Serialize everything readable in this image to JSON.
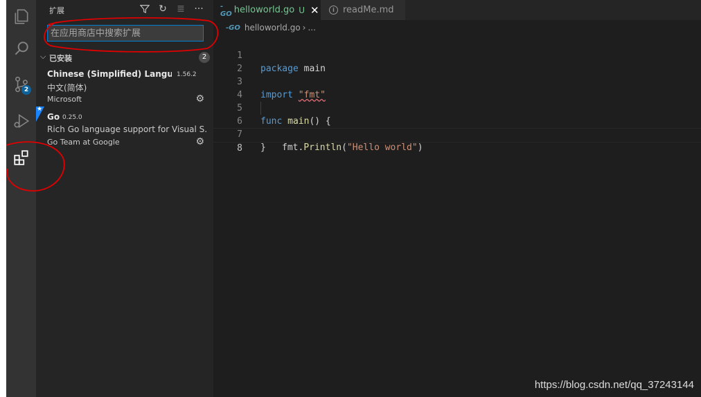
{
  "sidebar": {
    "title": "扩展",
    "search": {
      "placeholder": "在应用商店中搜索扩展",
      "value": ""
    },
    "section": {
      "label": "已安装",
      "count": "2"
    },
    "extensions": [
      {
        "name": "Chinese (Simplified) Langu...",
        "version": "1.56.2",
        "description": "中文(简体)",
        "publisher": "Microsoft"
      },
      {
        "name": "Go",
        "version": "0.25.0",
        "description": "Rich Go language support for Visual S...",
        "publisher": "Go Team at Google"
      }
    ]
  },
  "activity": {
    "scm_badge": "2"
  },
  "tabs": [
    {
      "label": "helloworld.go",
      "status": "U",
      "icon": "go-icon"
    },
    {
      "label": "readMe.md",
      "icon": "info-icon"
    }
  ],
  "breadcrumb": {
    "file": "helloworld.go",
    "more": "..."
  },
  "code": {
    "line_numbers": [
      "1",
      "2",
      "3",
      "4",
      "5",
      "6",
      "7",
      "8"
    ],
    "l1_kw": "package",
    "l1_rest": " main",
    "l3_kw": "import",
    "l3_str": "\"fmt\"",
    "l5_kw": "func",
    "l5_fn": "main",
    "l5_rest": "() {",
    "l6_pkg": "fmt.",
    "l6_fn": "Println",
    "l6_open": "(",
    "l6_str": "\"Hello world\"",
    "l6_close": ")",
    "l7": "}"
  },
  "watermark": "https://blog.csdn.net/qq_37243144",
  "colors": {
    "accent": "#007fd4",
    "annotation": "#e00000"
  }
}
